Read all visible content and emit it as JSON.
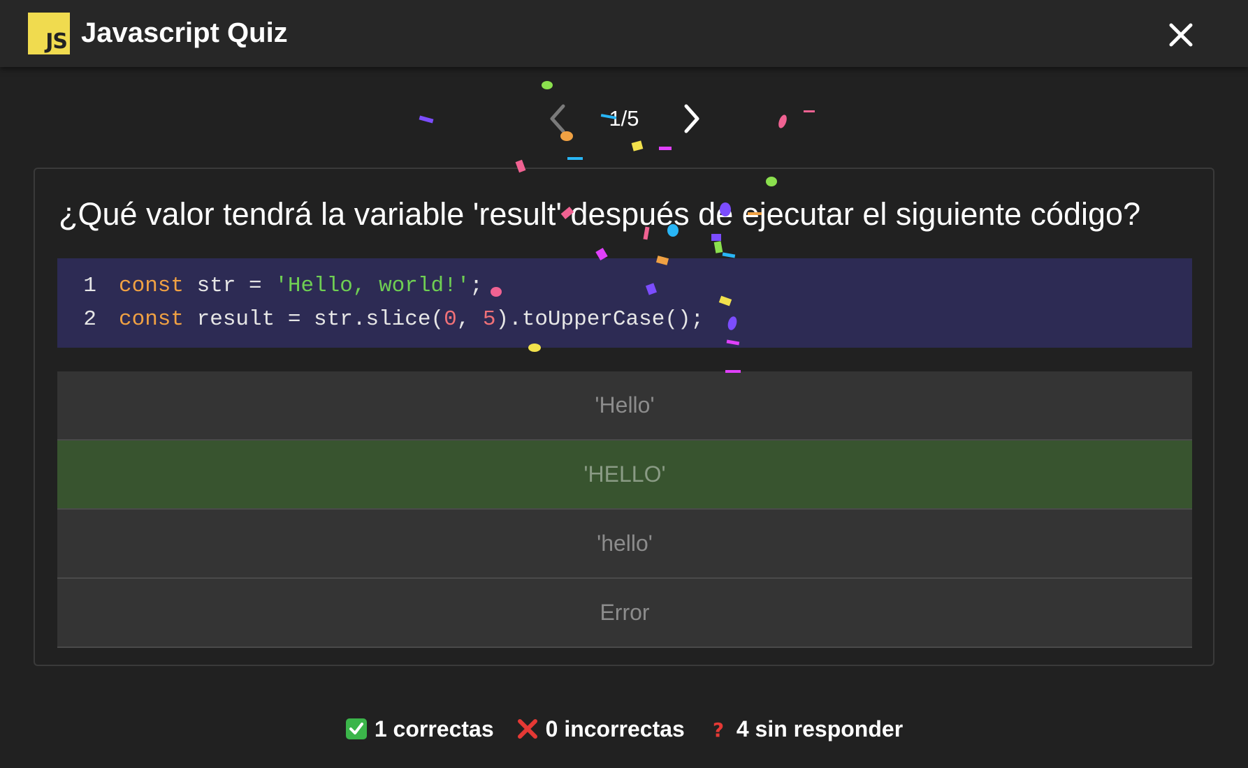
{
  "header": {
    "logo_text": "JS",
    "title": "Javascript Quiz",
    "close_icon": "close-icon"
  },
  "nav": {
    "counter": "1/5",
    "prev_icon": "chevron-left-icon",
    "next_icon": "chevron-right-icon"
  },
  "question": {
    "text": "¿Qué valor tendrá la variable 'result' después de ejecutar el siguiente código?",
    "code": {
      "line1": {
        "number": "1",
        "kw": "const",
        "name": " str = ",
        "string": "'Hello, world!'",
        "end": ";"
      },
      "line2": {
        "number": "2",
        "kw": "const",
        "name": " result = str.slice(",
        "num1": "0",
        "sep": ", ",
        "num2": "5",
        "end": ").toUpperCase();"
      }
    }
  },
  "answers": [
    {
      "label": "'Hello'",
      "state": "default"
    },
    {
      "label": "'HELLO'",
      "state": "correct"
    },
    {
      "label": "'hello'",
      "state": "default"
    },
    {
      "label": "Error",
      "state": "default"
    }
  ],
  "stats": {
    "correct": "1 correctas",
    "incorrect": "0 incorrectas",
    "unanswered": "4 sin responder"
  },
  "colors": {
    "background": "#212121",
    "code_background": "#2d2b54",
    "correct_answer": "#38542f",
    "logo": "#f0db4f"
  }
}
